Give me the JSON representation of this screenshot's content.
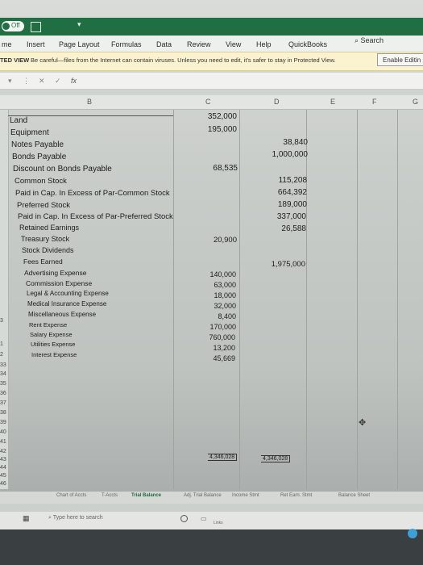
{
  "title_bar": {
    "autosave_label": "Off",
    "dropdown_caret": "▾"
  },
  "tabs": [
    "me",
    "Insert",
    "Page Layout",
    "Formulas",
    "Data",
    "Review",
    "View",
    "Help",
    "QuickBooks"
  ],
  "search_label": "Search",
  "protected_view": {
    "label": "TED VIEW",
    "message": "Be careful—files from the Internet can contain viruses. Unless you need to edit, it's safer to stay in Protected View.",
    "button": "Enable Editin"
  },
  "formula_bar": {
    "cancel": "✕",
    "enter": "✓",
    "fx": "fx",
    "caret": "▾",
    "more": "⋮"
  },
  "columns": [
    "B",
    "C",
    "D",
    "E",
    "F",
    "G"
  ],
  "row_numbers": [
    "3",
    "1",
    "2",
    "33",
    "34",
    "35",
    "36",
    "37",
    "38",
    "39",
    "40",
    "41",
    "42",
    "43",
    "44",
    "45",
    "46"
  ],
  "accounts": [
    "Land",
    "Equipment",
    "Notes Payable",
    "Bonds Payable",
    "Discount on Bonds Payable",
    "Common Stock",
    "Paid in Cap. In Excess of Par-Common Stock",
    "Preferred Stock",
    "Paid in Cap. In Excess of Par-Preferred Stock",
    "Retained Earnings",
    "Treasury Stock",
    "Stock Dividends",
    "Fees Earned",
    "Advertising Expense",
    "Commission Expense",
    "Legal & Accounting Expense",
    "Medical Insurance Expense",
    "Miscellaneous Expense",
    "Rent Expense",
    "Salary Expense",
    "Utilities Expense",
    "Interest Expense"
  ],
  "debits": [
    "352,000",
    "195,000",
    "68,535",
    "20,900",
    "140,000",
    "63,000",
    "18,000",
    "32,000",
    "8,400",
    "170,000",
    "760,000",
    "13,200",
    "45,669"
  ],
  "credits": [
    "38,840",
    "1,000,000",
    "115,208",
    "664,392",
    "189,000",
    "337,000",
    "26,588",
    "1,975,000"
  ],
  "totals": {
    "debit": "4,346,028",
    "credit": "4,346,028"
  },
  "sheet_tabs": [
    "Chart of Accts",
    "T-Accts",
    "Trial Balance",
    "Adj. Trial Balance",
    "Income Stmt",
    "Ret Earn. Stmt",
    "Balance Sheet"
  ],
  "taskbar": {
    "search_placeholder": "Type here to search",
    "links": "Links"
  },
  "colors": {
    "excel_green": "#1f6f43",
    "protected_yellow": "#fbf3cf"
  }
}
